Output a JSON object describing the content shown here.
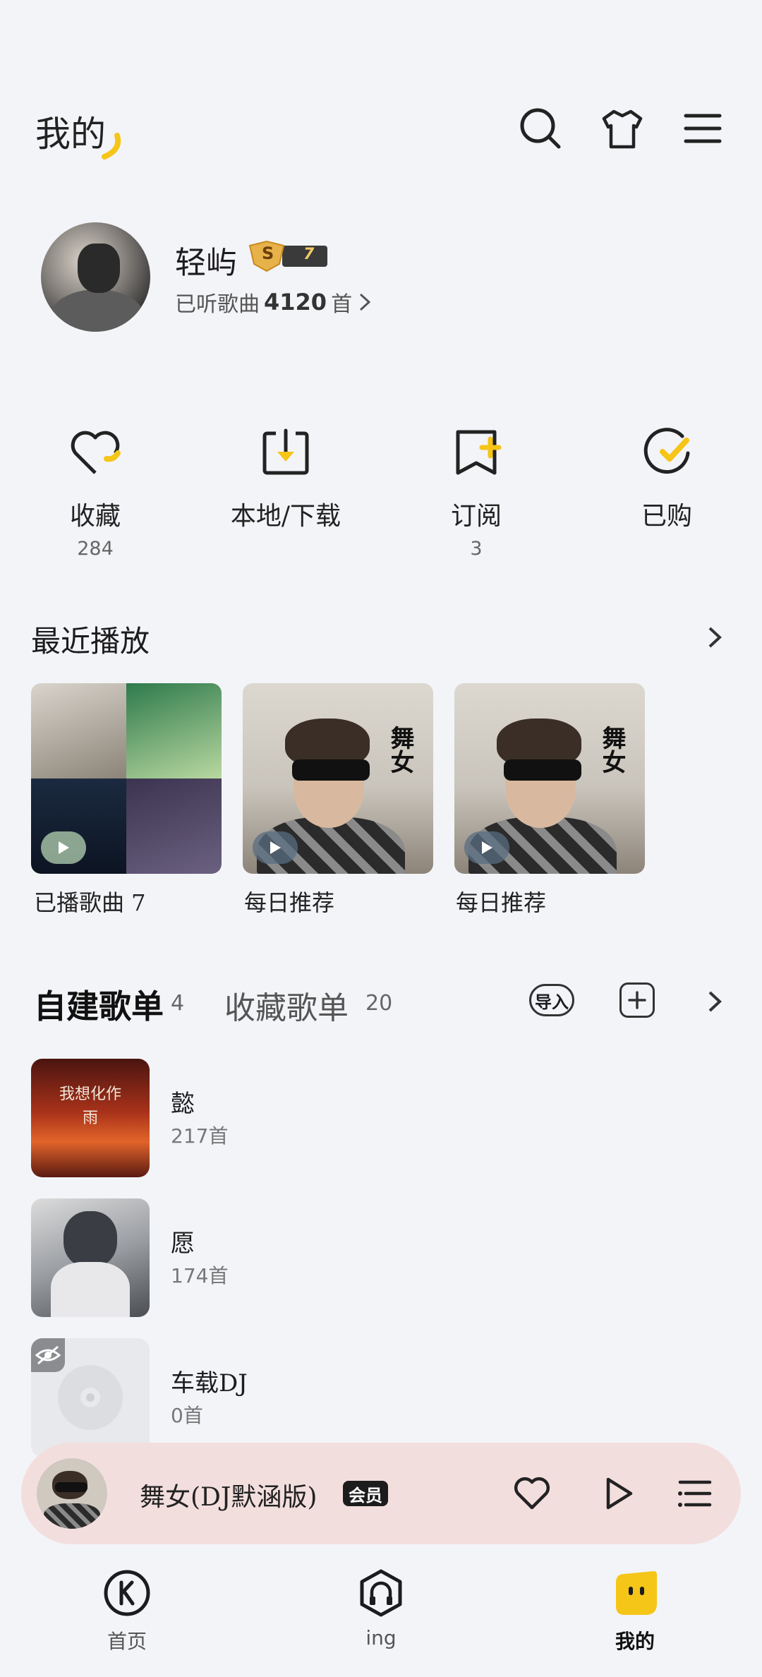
{
  "header": {
    "title": "我的"
  },
  "profile": {
    "name": "轻屿",
    "badge_level": "S",
    "badge_num": "7",
    "listened_prefix": "已听歌曲",
    "listened_count": "4120",
    "listened_suffix": "首"
  },
  "quick_actions": [
    {
      "label": "收藏",
      "count": "284"
    },
    {
      "label": "本地/下载",
      "count": ""
    },
    {
      "label": "订阅",
      "count": "3"
    },
    {
      "label": "已购",
      "count": ""
    }
  ],
  "recent": {
    "title": "最近播放",
    "cards": [
      {
        "label": "已播歌曲 7"
      },
      {
        "label": "每日推荐",
        "art_text": "舞女"
      },
      {
        "label": "每日推荐",
        "art_text": "舞女"
      }
    ]
  },
  "playlists": {
    "tab_created": "自建歌单",
    "tab_created_count": "4",
    "tab_fav": "收藏歌单",
    "tab_fav_count": "20",
    "import_label": "导入",
    "items": [
      {
        "name": "懿",
        "count": "217首",
        "art_text": "我想化作雨"
      },
      {
        "name": "愿",
        "count": "174首"
      },
      {
        "name": "车载DJ",
        "count": "0首"
      }
    ]
  },
  "player": {
    "title": "舞女(DJ默涵版)",
    "vip_label": "会员"
  },
  "nav": [
    {
      "label": "首页"
    },
    {
      "label": "ing"
    },
    {
      "label": "我的"
    }
  ],
  "colors": {
    "accent": "#f5c518",
    "background": "#f3f4f8",
    "player_bg": "#f3dede"
  }
}
